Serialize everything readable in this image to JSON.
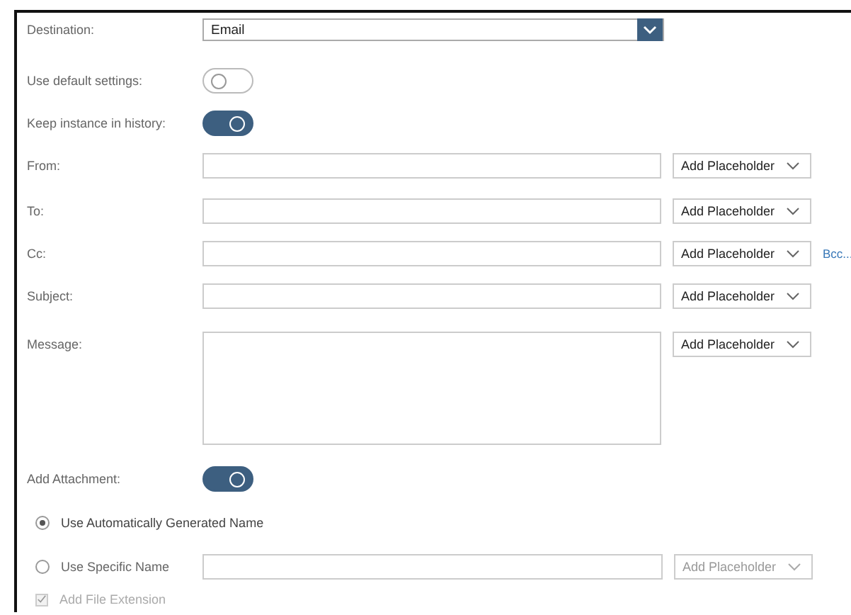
{
  "destination": {
    "label": "Destination:",
    "value": "Email"
  },
  "toggles": [
    {
      "label": "Use default settings:",
      "on": false
    },
    {
      "label": "Keep instance in history:",
      "on": true
    }
  ],
  "fields": [
    {
      "label": "From:",
      "kind": "line",
      "placeholder_button": "Add Placeholder"
    },
    {
      "label": "To:",
      "kind": "line",
      "placeholder_button": "Add Placeholder"
    },
    {
      "label": "Cc:",
      "kind": "line",
      "placeholder_button": "Add Placeholder",
      "link": "Bcc..."
    },
    {
      "label": "Subject:",
      "kind": "line",
      "placeholder_button": "Add Placeholder"
    },
    {
      "label": "Message:",
      "kind": "area",
      "placeholder_button": "Add Placeholder"
    }
  ],
  "attachment": {
    "label": "Add Attachment:",
    "on": true
  },
  "name_options": [
    {
      "label": "Use Automatically Generated Name",
      "selected": true
    },
    {
      "label": "Use Specific Name",
      "selected": false,
      "placeholder_button": "Add Placeholder"
    }
  ],
  "extension": {
    "label": "Add File Extension",
    "checked": true,
    "disabled": true
  }
}
